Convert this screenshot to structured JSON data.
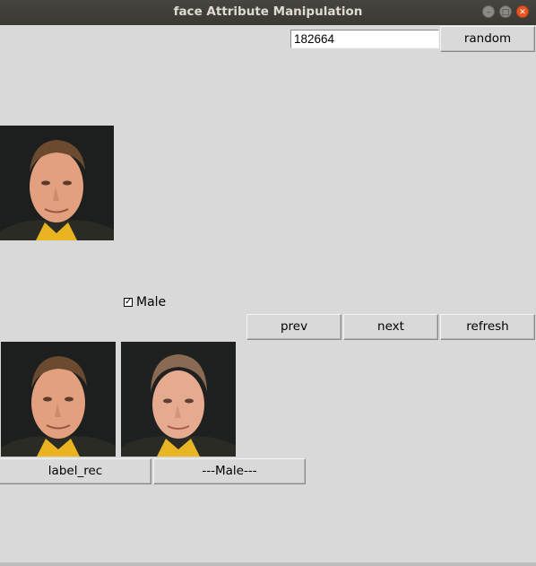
{
  "window": {
    "title": "face Attribute Manipulation",
    "controls": [
      "minimize-icon",
      "maximize-icon",
      "close-icon"
    ]
  },
  "top_bar": {
    "index_value": "182664",
    "random_label": "random"
  },
  "attribute": {
    "checkbox_checked": true,
    "label": "Male"
  },
  "nav": {
    "prev_label": "prev",
    "next_label": "next",
    "refresh_label": "refresh"
  },
  "results": {
    "label_rec": "label_rec",
    "attribute_label": "---Male---"
  },
  "images": {
    "original": "face-photo-original",
    "reconstruction": "face-photo-reconstruction",
    "manipulated": "face-photo-manipulated"
  }
}
